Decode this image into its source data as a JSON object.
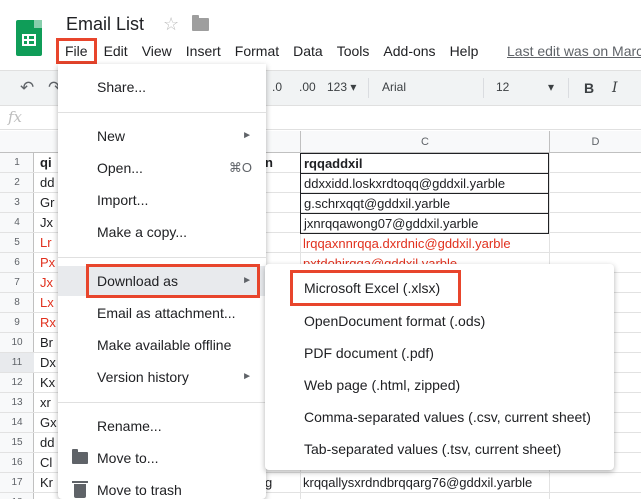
{
  "doc": {
    "title": "Email List",
    "last_edit": "Last edit was on Marc"
  },
  "menubar": [
    "File",
    "Edit",
    "View",
    "Insert",
    "Format",
    "Data",
    "Tools",
    "Add-ons",
    "Help"
  ],
  "toolbar": {
    "decimal_decrease": ".0",
    "decimal_increase": ".00",
    "more_formats": "123",
    "font": "Arial",
    "font_size": "12",
    "formula_label": "fx"
  },
  "columns": {
    "col_c": "C",
    "col_d": "D"
  },
  "rows": [
    "1",
    "2",
    "3",
    "4",
    "5",
    "6",
    "7",
    "8",
    "9",
    "10",
    "11",
    "12",
    "13",
    "14",
    "15",
    "16",
    "17",
    "18"
  ],
  "col_a_fragments": [
    "qi",
    "dd",
    "Gr",
    "Jx",
    "Lr",
    "Px",
    "Jx",
    "Lx",
    "Rx",
    "Br",
    "Dx",
    "Kx",
    "xr",
    "Gx",
    "dd",
    "Cl",
    "Kr"
  ],
  "col_b_fragments": {
    "r1": "n",
    "r17": "g"
  },
  "col_c": {
    "header": "rqqaddxil",
    "r2": "ddxxidd.loskxrdtoqq@gddxil.yarble",
    "r3": "g.schrxqqt@gddxil.yarble",
    "r4": "jxnrqqawong07@gddxil.yarble",
    "r5": "lrqqaxnnrqqa.dxrdnic@gddxil.yarble",
    "r6": "pxtdohirqqa@gddxil.yarble",
    "r17": "krqqallysxrdndbrqqarg76@gddxil.yarble"
  },
  "file_menu": {
    "share": "Share...",
    "new": "New",
    "open": "Open...",
    "open_shortcut": "⌘O",
    "import": "Import...",
    "make_copy": "Make a copy...",
    "download_as": "Download as",
    "email_attachment": "Email as attachment...",
    "offline": "Make available offline",
    "version_history": "Version history",
    "rename": "Rename...",
    "move_to": "Move to...",
    "move_trash": "Move to trash",
    "arrow": "►"
  },
  "download_submenu": [
    "Microsoft Excel (.xlsx)",
    "OpenDocument format (.ods)",
    "PDF document (.pdf)",
    "Web page (.html, zipped)",
    "Comma-separated values (.csv, current sheet)",
    "Tab-separated values (.tsv, current sheet)"
  ],
  "colors": {
    "accent_red": "#e8452c",
    "red_text": "#e1311e",
    "sheets_green": "#0f9d58"
  },
  "icons": [
    "sheets-logo-icon",
    "star-icon",
    "folder-icon",
    "undo-icon",
    "redo-icon",
    "fx-icon",
    "folder-menu-icon",
    "trash-icon"
  ]
}
